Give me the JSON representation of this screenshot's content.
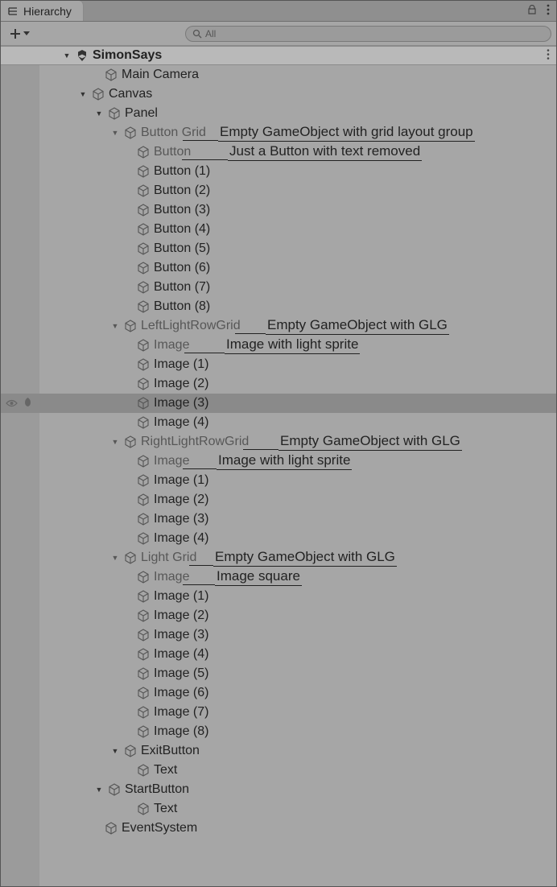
{
  "tab": {
    "title": "Hierarchy"
  },
  "toolbar": {
    "search_placeholder": "All"
  },
  "scene": {
    "name": "SimonSays"
  },
  "nodes": {
    "main_camera": "Main Camera",
    "canvas": "Canvas",
    "panel": "Panel",
    "button_grid": "Button Grid",
    "button": "Button",
    "button1": "Button (1)",
    "button2": "Button (2)",
    "button3": "Button (3)",
    "button4": "Button (4)",
    "button5": "Button (5)",
    "button6": "Button (6)",
    "button7": "Button (7)",
    "button8": "Button (8)",
    "left_light": "LeftLightRowGrid",
    "image": "Image",
    "image1": "Image (1)",
    "image2": "Image (2)",
    "image3": "Image (3)",
    "image4": "Image (4)",
    "right_light": "RightLightRowGrid",
    "light_grid": "Light Grid",
    "image5": "Image (5)",
    "image6": "Image (6)",
    "image7": "Image (7)",
    "image8": "Image (8)",
    "exit_button": "ExitButton",
    "text": "Text",
    "start_button": "StartButton",
    "event_system": "EventSystem"
  },
  "annotations": {
    "button_grid": "Empty GameObject with grid layout group",
    "button": "Just a Button with text removed",
    "left_light": "Empty GameObject with GLG",
    "ll_image": "Image with light sprite",
    "right_light": "Empty GameObject with GLG",
    "rl_image": "Image with light sprite",
    "light_grid": "Empty GameObject with GLG",
    "lg_image": "Image square"
  }
}
